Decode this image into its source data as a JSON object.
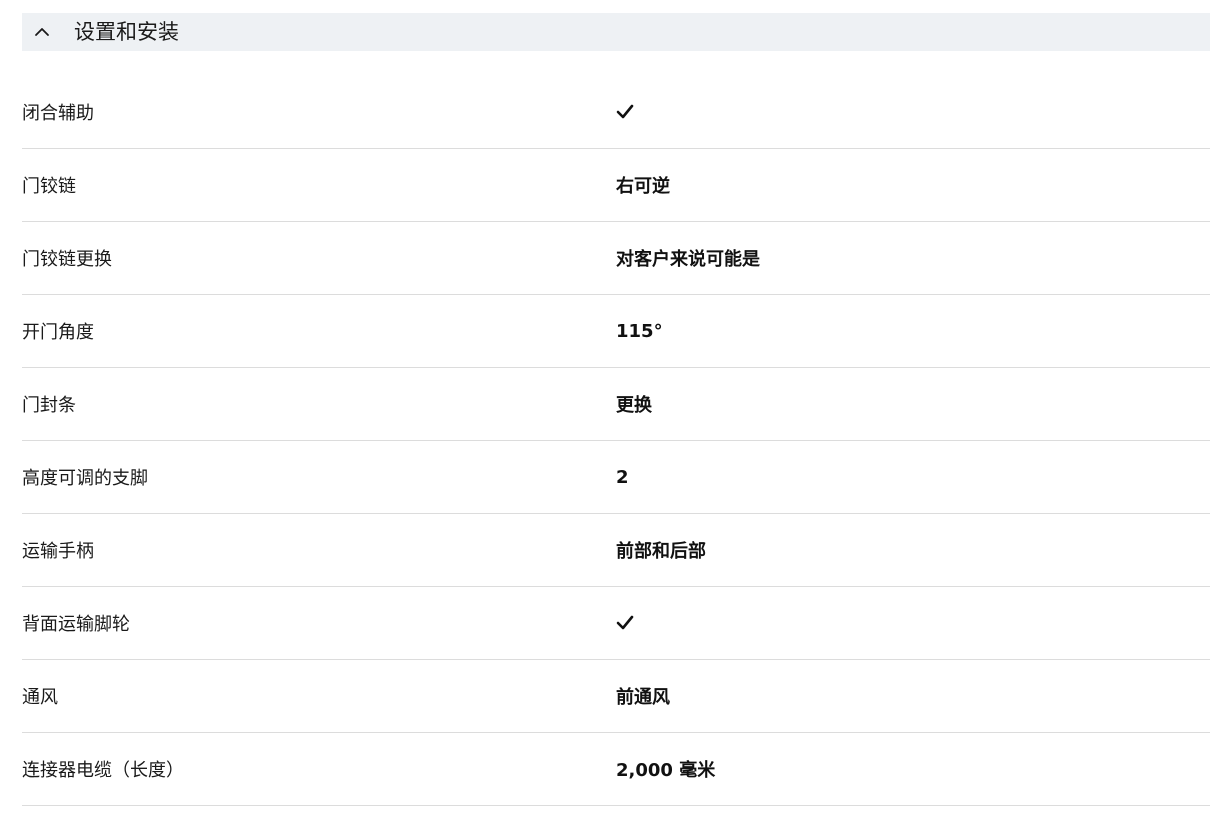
{
  "section": {
    "title": "设置和安装",
    "chevron_icon": "chevron-up-icon",
    "expanded": true
  },
  "specs": [
    {
      "label": "闭合辅助",
      "value": "",
      "icon": "checkmark-icon"
    },
    {
      "label": "门铰链",
      "value": "右可逆"
    },
    {
      "label": "门铰链更换",
      "value": "对客户来说可能是"
    },
    {
      "label": "开门角度",
      "value": "115°"
    },
    {
      "label": "门封条",
      "value": "更换"
    },
    {
      "label": "高度可调的支脚",
      "value": "2"
    },
    {
      "label": "运输手柄",
      "value": "前部和后部"
    },
    {
      "label": "背面运输脚轮",
      "value": "",
      "icon": "checkmark-icon"
    },
    {
      "label": "通风",
      "value": "前通风"
    },
    {
      "label": "连接器电缆（长度）",
      "value": "2,000 毫米"
    }
  ],
  "colors": {
    "header_bg": "#eef1f4",
    "divider": "#dcdcdc",
    "text": "#1a1a1a"
  }
}
